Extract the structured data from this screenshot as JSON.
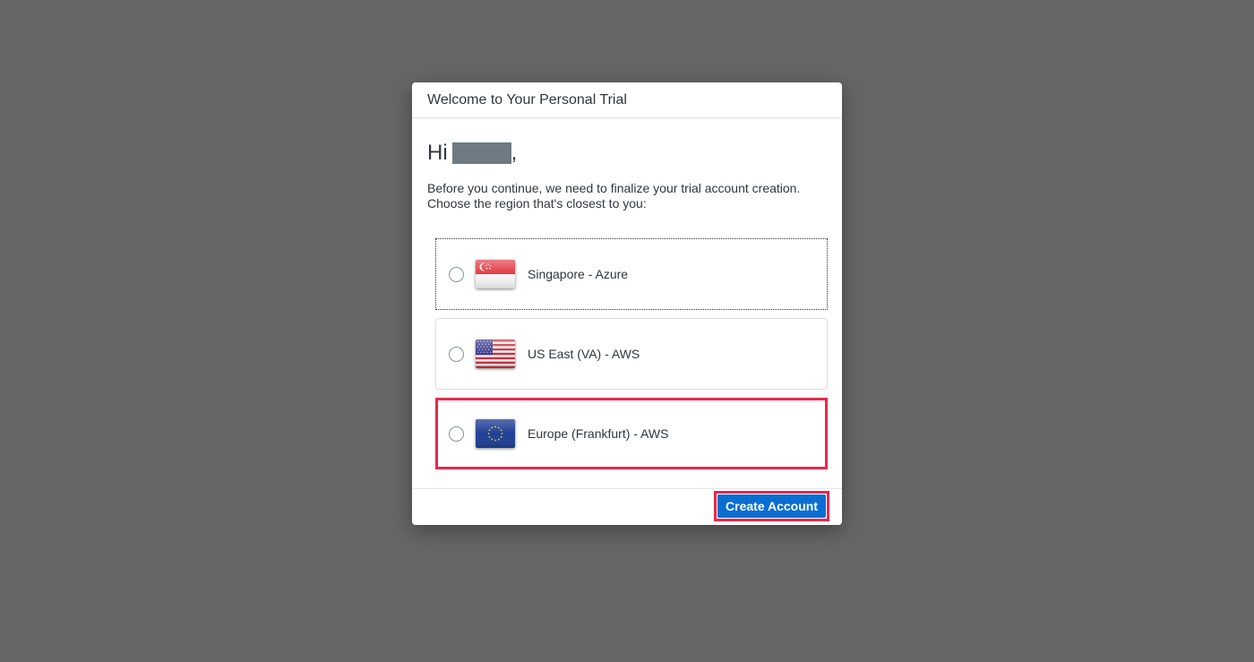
{
  "dialog": {
    "title": "Welcome to Your Personal Trial",
    "greeting": "Hi",
    "greeting_suffix": ",",
    "intro_line1": "Before you continue, we need to finalize your trial account creation.",
    "intro_line2": "Choose the region that's closest to you:"
  },
  "regions": [
    {
      "label": "Singapore - Azure",
      "flag_icon": "singapore-flag-icon",
      "selected": false
    },
    {
      "label": "US East (VA) - AWS",
      "flag_icon": "us-flag-icon",
      "selected": false
    },
    {
      "label": "Europe (Frankfurt) - AWS",
      "flag_icon": "eu-flag-icon",
      "selected": false
    }
  ],
  "footer": {
    "create_label": "Create Account"
  },
  "colors": {
    "overlay": "#666666",
    "primary_button": "#0a6ed1",
    "highlight": "#e8294a"
  }
}
